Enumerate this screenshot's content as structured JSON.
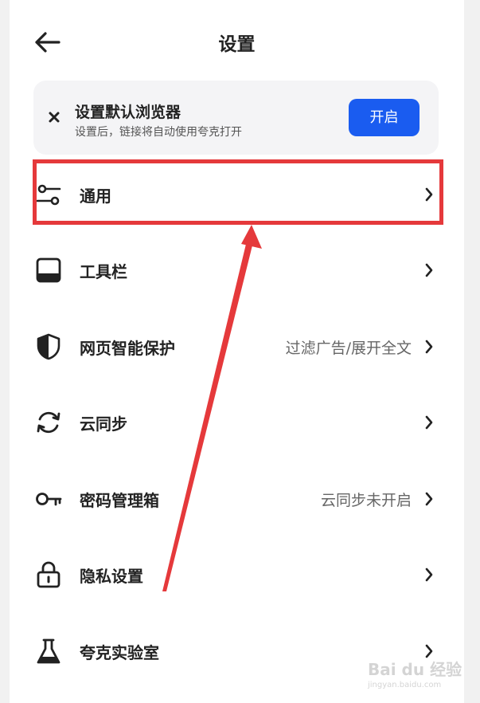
{
  "header": {
    "title": "设置"
  },
  "banner": {
    "title": "设置默认浏览器",
    "subtitle": "设置后，链接将自动使用夸克打开",
    "button": "开启"
  },
  "rows": [
    {
      "label": "通用",
      "value": "",
      "icon": "sliders-icon"
    },
    {
      "label": "工具栏",
      "value": "",
      "icon": "toolbar-icon"
    },
    {
      "label": "网页智能保护",
      "value": "过滤广告/展开全文",
      "icon": "shield-icon"
    },
    {
      "label": "云同步",
      "value": "",
      "icon": "sync-icon"
    },
    {
      "label": "密码管理箱",
      "value": "云同步未开启",
      "icon": "key-icon"
    },
    {
      "label": "隐私设置",
      "value": "",
      "icon": "lock-icon"
    },
    {
      "label": "夸克实验室",
      "value": "",
      "icon": "flask-icon"
    }
  ],
  "annotation": {
    "highlight_color": "#e5393b"
  },
  "watermark": {
    "text": "Bai du 经验",
    "sub": "jingyan.baidu.com"
  },
  "colors": {
    "accent": "#1a5cf0",
    "background": "#f1f1f1"
  }
}
